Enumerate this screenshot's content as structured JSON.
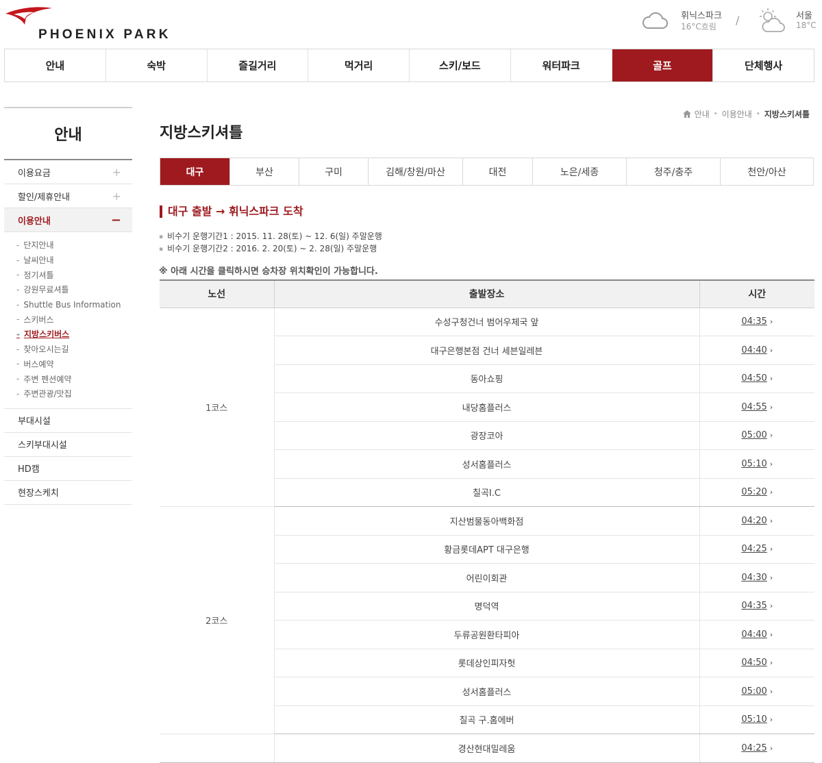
{
  "header": {
    "logo_text": "PHOENIX PARK",
    "weather": [
      {
        "place": "휘닉스파크",
        "temp": "16°C흐림",
        "icon": "cloud-icon"
      },
      {
        "place": "서울",
        "temp": "18°C",
        "icon": "sun-cloud-icon"
      }
    ],
    "separator": "/"
  },
  "gnb": [
    {
      "label": "안내",
      "active": false
    },
    {
      "label": "숙박",
      "active": false
    },
    {
      "label": "즐길거리",
      "active": false
    },
    {
      "label": "먹거리",
      "active": false
    },
    {
      "label": "스키/보드",
      "active": false
    },
    {
      "label": "워터파크",
      "active": false
    },
    {
      "label": "골프",
      "active": true
    },
    {
      "label": "단체행사",
      "active": false
    }
  ],
  "sidebar": {
    "title": "안내",
    "top_items": [
      {
        "label": "이용요금",
        "sign": "+"
      },
      {
        "label": "할인/제휴안내",
        "sign": "+"
      },
      {
        "label": "이용안내",
        "sign": "−",
        "active": true
      }
    ],
    "sub_items": [
      "단지안내",
      "날씨안내",
      "정기셔틀",
      "강원무료셔틀",
      "Shuttle Bus Information",
      "스키버스",
      "지방스키버스",
      "찾아오시는길",
      "버스예약",
      "주변 펜션예약",
      "주변관광/맛집"
    ],
    "current_sub": "지방스키버스",
    "bottom_items": [
      "부대시설",
      "스키부대시설",
      "HD캠",
      "현장스케치"
    ]
  },
  "breadcrumb": [
    "안내",
    "이용안내",
    "지방스키셔틀"
  ],
  "page_title": "지방스키셔틀",
  "tabs": [
    {
      "label": "대구",
      "active": true
    },
    {
      "label": "부산"
    },
    {
      "label": "구미"
    },
    {
      "label": "김해/창원/마산"
    },
    {
      "label": "대전"
    },
    {
      "label": "노은/세종"
    },
    {
      "label": "청주/충주"
    },
    {
      "label": "천안/아산"
    }
  ],
  "section_title": "대구 출발 → 휘닉스파크 도착",
  "periods": [
    "비수기 운행기간1 : 2015. 11. 28(토) ~ 12. 6(일) 주말운행",
    "비수기 운행기간2 : 2016. 2. 20(토) ~ 2. 28(일) 주말운행"
  ],
  "notice": "※ 아래 시간을 클릭하시면 승차장 위치확인이 가능합니다.",
  "table": {
    "headers": [
      "노선",
      "출발장소",
      "시간"
    ],
    "groups": [
      {
        "course": "1코스",
        "rows": [
          {
            "place": "수성구청건너 범어우체국 앞",
            "time": "04:35"
          },
          {
            "place": "대구은행본점 건너 세븐일레븐",
            "time": "04:40"
          },
          {
            "place": "동아쇼핑",
            "time": "04:50"
          },
          {
            "place": "내당홈플러스",
            "time": "04:55"
          },
          {
            "place": "광장코아",
            "time": "05:00"
          },
          {
            "place": "성서홈플러스",
            "time": "05:10"
          },
          {
            "place": "칠곡I.C",
            "time": "05:20"
          }
        ]
      },
      {
        "course": "2코스",
        "rows": [
          {
            "place": "지산범물동아백화점",
            "time": "04:20"
          },
          {
            "place": "황금롯데APT 대구은행",
            "time": "04:25"
          },
          {
            "place": "어린이회관",
            "time": "04:30"
          },
          {
            "place": "명덕역",
            "time": "04:35"
          },
          {
            "place": "두류공원환타피아",
            "time": "04:40"
          },
          {
            "place": "롯데상인피자헛",
            "time": "04:50"
          },
          {
            "place": "성서홈플러스",
            "time": "05:00"
          },
          {
            "place": "칠곡 구.홈에버",
            "time": "05:10"
          }
        ]
      },
      {
        "course": "",
        "rows": [
          {
            "place": "경산현대밀레움",
            "time": "04:25"
          }
        ]
      }
    ]
  },
  "colors": {
    "brand": "#9e1a1e",
    "header_bg": "#f1f1f1"
  }
}
